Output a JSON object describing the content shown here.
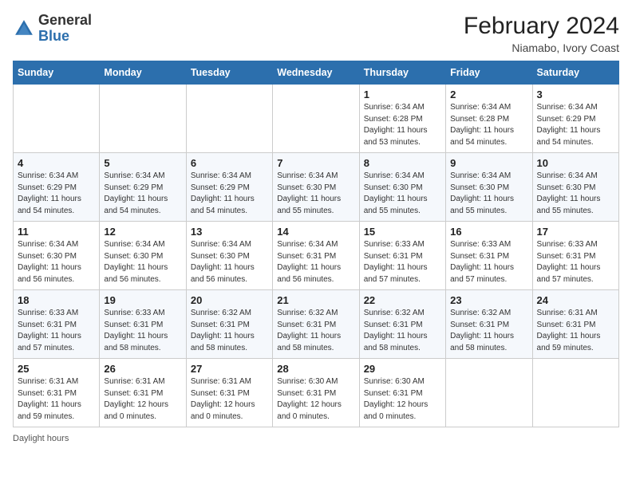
{
  "header": {
    "logo": {
      "general": "General",
      "blue": "Blue"
    },
    "month_year": "February 2024",
    "location": "Niamabo, Ivory Coast"
  },
  "days_of_week": [
    "Sunday",
    "Monday",
    "Tuesday",
    "Wednesday",
    "Thursday",
    "Friday",
    "Saturday"
  ],
  "weeks": [
    [
      {
        "day": "",
        "detail": ""
      },
      {
        "day": "",
        "detail": ""
      },
      {
        "day": "",
        "detail": ""
      },
      {
        "day": "",
        "detail": ""
      },
      {
        "day": "1",
        "detail": "Sunrise: 6:34 AM\nSunset: 6:28 PM\nDaylight: 11 hours\nand 53 minutes."
      },
      {
        "day": "2",
        "detail": "Sunrise: 6:34 AM\nSunset: 6:28 PM\nDaylight: 11 hours\nand 54 minutes."
      },
      {
        "day": "3",
        "detail": "Sunrise: 6:34 AM\nSunset: 6:29 PM\nDaylight: 11 hours\nand 54 minutes."
      }
    ],
    [
      {
        "day": "4",
        "detail": "Sunrise: 6:34 AM\nSunset: 6:29 PM\nDaylight: 11 hours\nand 54 minutes."
      },
      {
        "day": "5",
        "detail": "Sunrise: 6:34 AM\nSunset: 6:29 PM\nDaylight: 11 hours\nand 54 minutes."
      },
      {
        "day": "6",
        "detail": "Sunrise: 6:34 AM\nSunset: 6:29 PM\nDaylight: 11 hours\nand 54 minutes."
      },
      {
        "day": "7",
        "detail": "Sunrise: 6:34 AM\nSunset: 6:30 PM\nDaylight: 11 hours\nand 55 minutes."
      },
      {
        "day": "8",
        "detail": "Sunrise: 6:34 AM\nSunset: 6:30 PM\nDaylight: 11 hours\nand 55 minutes."
      },
      {
        "day": "9",
        "detail": "Sunrise: 6:34 AM\nSunset: 6:30 PM\nDaylight: 11 hours\nand 55 minutes."
      },
      {
        "day": "10",
        "detail": "Sunrise: 6:34 AM\nSunset: 6:30 PM\nDaylight: 11 hours\nand 55 minutes."
      }
    ],
    [
      {
        "day": "11",
        "detail": "Sunrise: 6:34 AM\nSunset: 6:30 PM\nDaylight: 11 hours\nand 56 minutes."
      },
      {
        "day": "12",
        "detail": "Sunrise: 6:34 AM\nSunset: 6:30 PM\nDaylight: 11 hours\nand 56 minutes."
      },
      {
        "day": "13",
        "detail": "Sunrise: 6:34 AM\nSunset: 6:30 PM\nDaylight: 11 hours\nand 56 minutes."
      },
      {
        "day": "14",
        "detail": "Sunrise: 6:34 AM\nSunset: 6:31 PM\nDaylight: 11 hours\nand 56 minutes."
      },
      {
        "day": "15",
        "detail": "Sunrise: 6:33 AM\nSunset: 6:31 PM\nDaylight: 11 hours\nand 57 minutes."
      },
      {
        "day": "16",
        "detail": "Sunrise: 6:33 AM\nSunset: 6:31 PM\nDaylight: 11 hours\nand 57 minutes."
      },
      {
        "day": "17",
        "detail": "Sunrise: 6:33 AM\nSunset: 6:31 PM\nDaylight: 11 hours\nand 57 minutes."
      }
    ],
    [
      {
        "day": "18",
        "detail": "Sunrise: 6:33 AM\nSunset: 6:31 PM\nDaylight: 11 hours\nand 57 minutes."
      },
      {
        "day": "19",
        "detail": "Sunrise: 6:33 AM\nSunset: 6:31 PM\nDaylight: 11 hours\nand 58 minutes."
      },
      {
        "day": "20",
        "detail": "Sunrise: 6:32 AM\nSunset: 6:31 PM\nDaylight: 11 hours\nand 58 minutes."
      },
      {
        "day": "21",
        "detail": "Sunrise: 6:32 AM\nSunset: 6:31 PM\nDaylight: 11 hours\nand 58 minutes."
      },
      {
        "day": "22",
        "detail": "Sunrise: 6:32 AM\nSunset: 6:31 PM\nDaylight: 11 hours\nand 58 minutes."
      },
      {
        "day": "23",
        "detail": "Sunrise: 6:32 AM\nSunset: 6:31 PM\nDaylight: 11 hours\nand 58 minutes."
      },
      {
        "day": "24",
        "detail": "Sunrise: 6:31 AM\nSunset: 6:31 PM\nDaylight: 11 hours\nand 59 minutes."
      }
    ],
    [
      {
        "day": "25",
        "detail": "Sunrise: 6:31 AM\nSunset: 6:31 PM\nDaylight: 11 hours\nand 59 minutes."
      },
      {
        "day": "26",
        "detail": "Sunrise: 6:31 AM\nSunset: 6:31 PM\nDaylight: 12 hours\nand 0 minutes."
      },
      {
        "day": "27",
        "detail": "Sunrise: 6:31 AM\nSunset: 6:31 PM\nDaylight: 12 hours\nand 0 minutes."
      },
      {
        "day": "28",
        "detail": "Sunrise: 6:30 AM\nSunset: 6:31 PM\nDaylight: 12 hours\nand 0 minutes."
      },
      {
        "day": "29",
        "detail": "Sunrise: 6:30 AM\nSunset: 6:31 PM\nDaylight: 12 hours\nand 0 minutes."
      },
      {
        "day": "",
        "detail": ""
      },
      {
        "day": "",
        "detail": ""
      }
    ]
  ],
  "footer": {
    "daylight_label": "Daylight hours"
  }
}
